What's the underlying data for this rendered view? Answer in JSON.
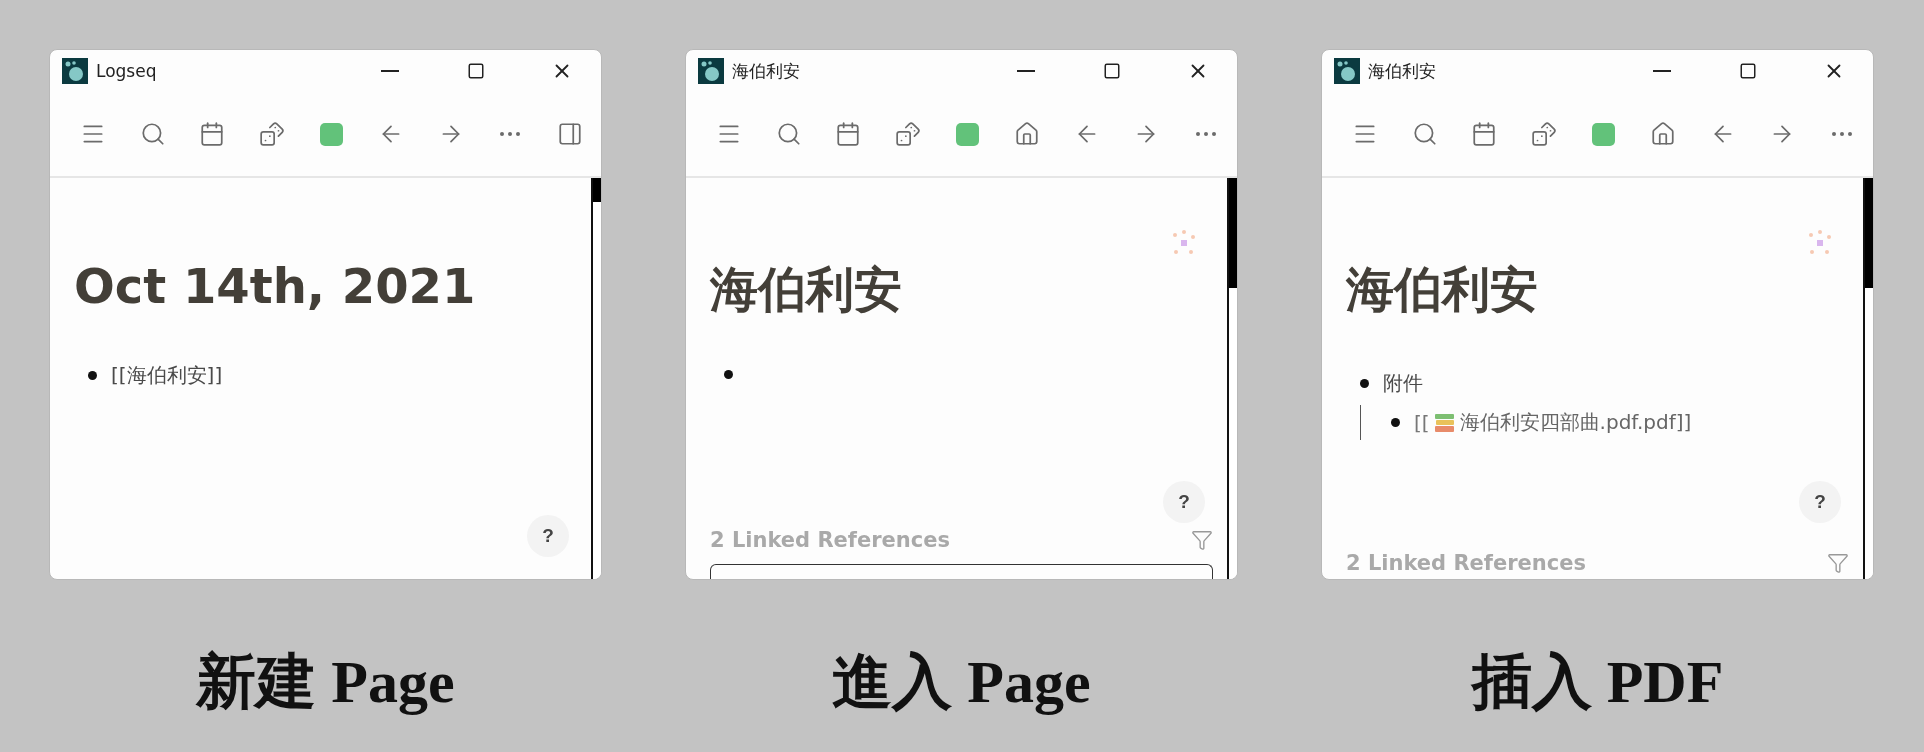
{
  "panels": [
    {
      "window": {
        "title": "Logseq",
        "toolbar": [
          {
            "kind": "menu"
          },
          {
            "kind": "search"
          },
          {
            "kind": "journal"
          },
          {
            "kind": "random"
          },
          {
            "kind": "theme"
          },
          {
            "kind": "back"
          },
          {
            "kind": "forward"
          },
          {
            "kind": "more"
          },
          {
            "kind": "sidebar"
          }
        ],
        "page_title": "Oct 14th, 2021",
        "graph_view": false,
        "blocks": [
          {
            "kind": "text",
            "text": "[[海伯利安]]"
          }
        ],
        "help": "?"
      },
      "caption": "新建 Page"
    },
    {
      "window": {
        "title": "海伯利安",
        "toolbar": [
          {
            "kind": "menu"
          },
          {
            "kind": "search"
          },
          {
            "kind": "journal"
          },
          {
            "kind": "random"
          },
          {
            "kind": "theme"
          },
          {
            "kind": "home"
          },
          {
            "kind": "back"
          },
          {
            "kind": "forward"
          },
          {
            "kind": "more"
          }
        ],
        "page_title": "海伯利安",
        "graph_view": true,
        "blocks": [
          {
            "kind": "empty"
          }
        ],
        "help": "?",
        "linked_references": "2 Linked References",
        "reference_box": true
      },
      "caption": "進入 Page"
    },
    {
      "window": {
        "title": "海伯利安",
        "toolbar": [
          {
            "kind": "menu"
          },
          {
            "kind": "search"
          },
          {
            "kind": "journal"
          },
          {
            "kind": "random"
          },
          {
            "kind": "theme"
          },
          {
            "kind": "home"
          },
          {
            "kind": "back"
          },
          {
            "kind": "forward"
          },
          {
            "kind": "more"
          }
        ],
        "page_title": "海伯利安",
        "graph_view": true,
        "blocks": [
          {
            "kind": "text",
            "text": "附件",
            "children": [
              {
                "kind": "asset",
                "prefix": "[[",
                "label": "海伯利安四部曲.pdf.pdf",
                "suffix": "]]"
              }
            ]
          }
        ],
        "help": "?",
        "linked_references": "2 Linked References",
        "reference_box": false
      },
      "caption": "插入 PDF"
    }
  ]
}
